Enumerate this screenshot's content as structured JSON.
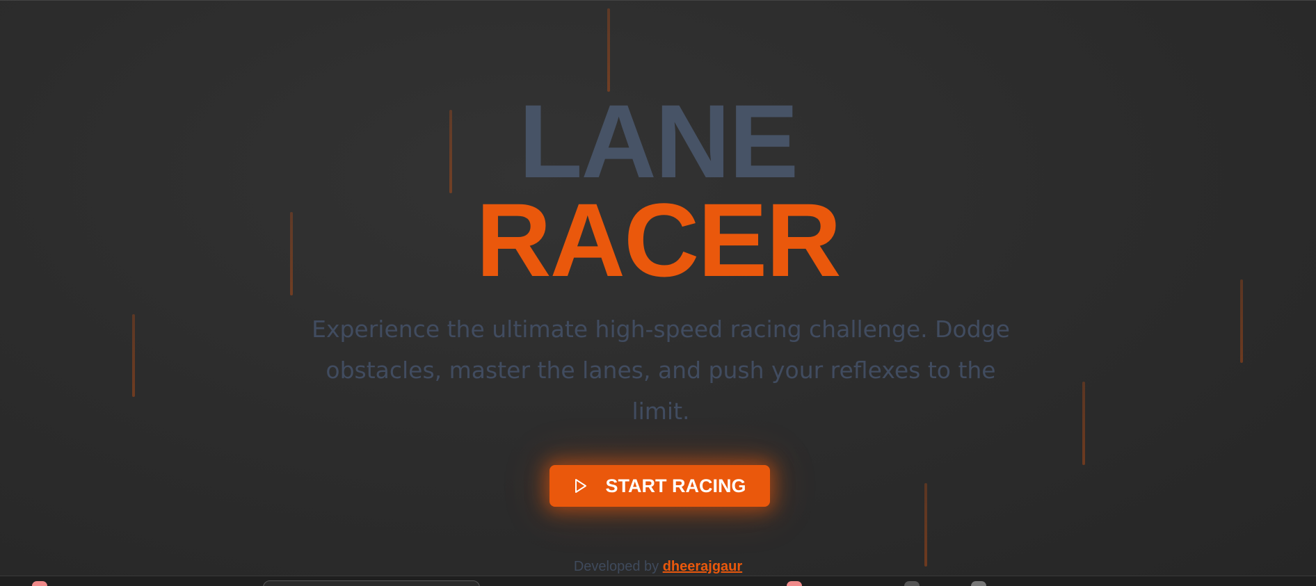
{
  "title": {
    "line1": "LANE",
    "line2": "RACER"
  },
  "tagline": "Experience the ultimate high-speed racing challenge. Dodge obstacles, master the lanes, and push your reflexes to the limit.",
  "start_button": {
    "label": "START RACING",
    "icon": "play-icon"
  },
  "footer": {
    "prefix": "Developed by",
    "author": "dheerajgaur"
  },
  "colors": {
    "accent": "#ea580c",
    "title_muted": "#475366",
    "text_muted": "#414c60",
    "background": "#2b2b2b"
  }
}
